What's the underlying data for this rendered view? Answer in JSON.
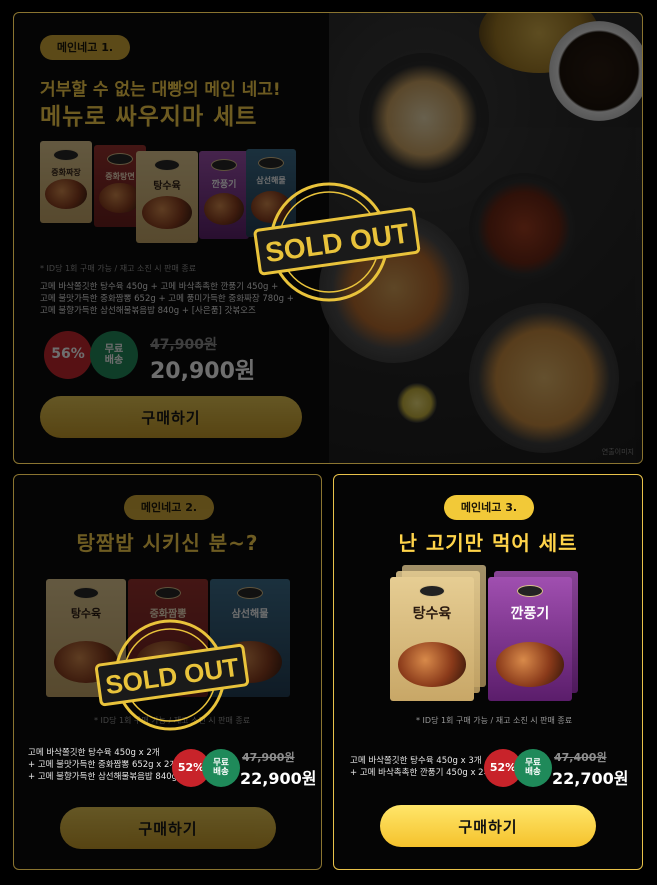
{
  "set1": {
    "tag": "메인네고 1.",
    "headline_line1": "거부할 수 없는 대빵의 메인 네고!",
    "headline_line2": "메뉴로 싸우지마 세트",
    "products": [
      "중화짜장",
      "중화탕면",
      "탕수육",
      "깐풍기",
      "삼선해물"
    ],
    "note": "* ID당 1회 구매 가능 / 재고 소진 시 판매 종료",
    "desc": [
      "고메 바삭쫄깃한 탕수육 450g + 고메 바삭촉촉한 깐풍기 450g +",
      "고메 불맛가득한 중화짬뽕 652g + 고메 풍미가득한 중화짜장 780g +",
      "고메 불향가득한 삼선해물볶음밥 840g + [사은품] 갓볶오즈"
    ],
    "discount": "56%",
    "shipping": "무료\n배송",
    "original_price": "47,900원",
    "price": "20,900원",
    "buy_label": "구매하기",
    "sold_out": "SOLD OUT",
    "image_caption": "연출이미지"
  },
  "set2": {
    "tag": "메인네고 2.",
    "headline": "탕짬밥 시키신 분~?",
    "products": [
      "탕수육",
      "중화짬뽕",
      "삼선해물"
    ],
    "note": "* ID당 1회 구매 가능 / 재고 소진 시 판매 종료",
    "desc": [
      "고메 바삭쫄깃한 탕수육 450g x 2개",
      "+ 고메 불맛가득한 중화짬뽕 652g x 2개",
      "+ 고메 불향가득한 삼선해물볶음밥 840g"
    ],
    "discount": "52%",
    "shipping": "무료\n배송",
    "original_price": "47,900원",
    "price": "22,900원",
    "buy_label": "구매하기",
    "sold_out": "SOLD OUT"
  },
  "set3": {
    "tag": "메인네고 3.",
    "headline": "난 고기만 먹어 세트",
    "products": [
      "탕수육",
      "깐풍기"
    ],
    "note": "* ID당 1회 구매 가능 / 재고 소진 시 판매 종료",
    "desc": [
      "고메 바삭쫄깃한 탕수육 450g x 3개",
      "+ 고메 바삭촉촉한 깐풍기 450g x 2개"
    ],
    "discount": "52%",
    "shipping": "무료\n배송",
    "original_price": "47,400원",
    "price": "22,700원",
    "buy_label": "구매하기"
  },
  "colors": {
    "accent": "#ffd44a",
    "gold": "#d7ad35",
    "discount_red": "#c8232a",
    "shipping_green": "#1f8a5a"
  }
}
